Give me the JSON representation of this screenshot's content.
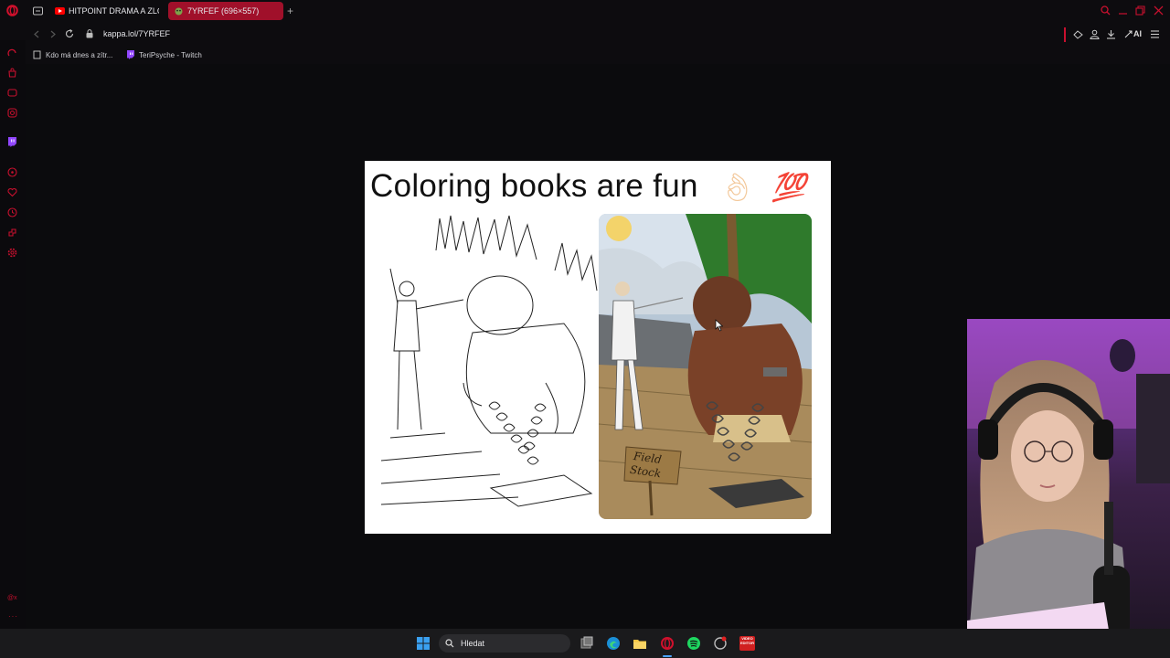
{
  "browser": {
    "tabs": [
      {
        "label": "HITPOINT DRAMA A ZLOD",
        "active": false
      },
      {
        "label": "7YRFEF (696×557)",
        "active": true
      }
    ],
    "new_tab": "+",
    "url": "kappa.lol/7YRFEF",
    "ai_label": "AI",
    "bookmarks": [
      {
        "label": "Kdo má dnes a zítr..."
      },
      {
        "label": "TeriPsyche - Twitch"
      }
    ],
    "sidebar_footer": "@x"
  },
  "meme": {
    "title": "Coloring books are fun",
    "emoji_hundred": "💯",
    "sign_line1": "Field",
    "sign_line2": "Stock"
  },
  "taskbar": {
    "search_placeholder": "Hledat",
    "video_badge": "VIDEO\nEDITOR"
  },
  "colors": {
    "accent": "#c8102e",
    "active_tab": "#a0102a",
    "taskbar": "#1a1a1c",
    "page_bg": "#0b0b0d"
  }
}
